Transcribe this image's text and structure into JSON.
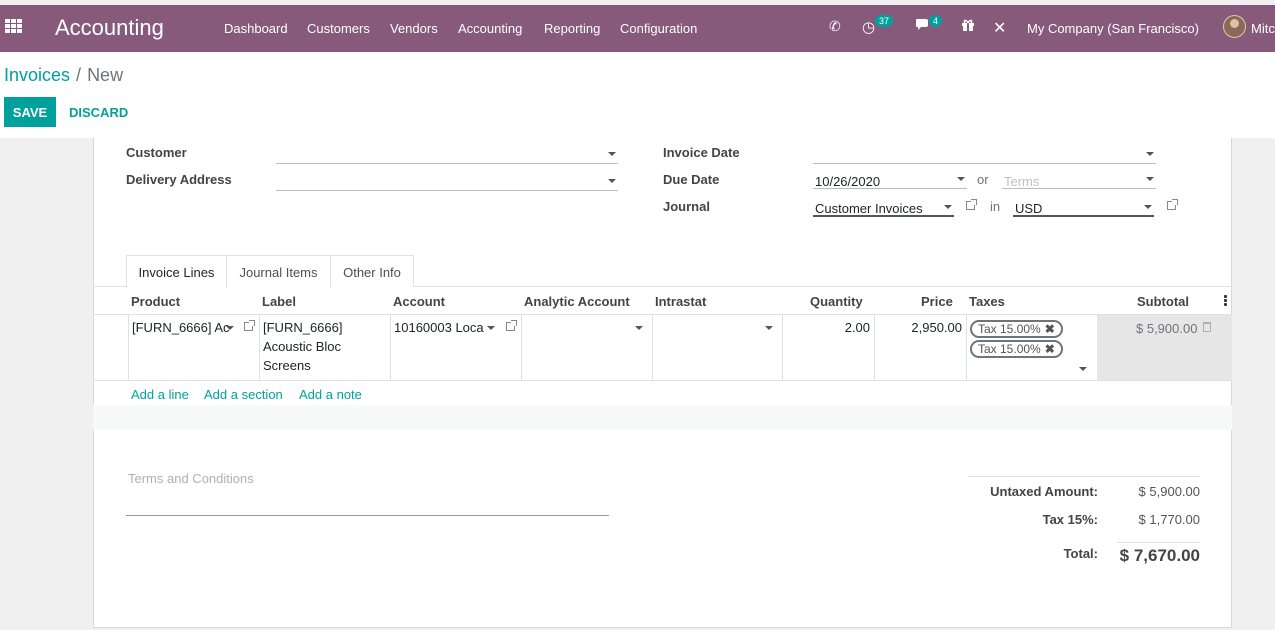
{
  "app": {
    "name": "Accounting"
  },
  "nav": {
    "items": [
      "Dashboard",
      "Customers",
      "Vendors",
      "Accounting",
      "Reporting",
      "Configuration"
    ]
  },
  "systray": {
    "activity_count": "37",
    "message_count": "4",
    "company": "My Company (San Francisco)",
    "user": "Mitc"
  },
  "breadcrumb": {
    "parent": "Invoices",
    "separator": "/",
    "current": "New"
  },
  "buttons": {
    "save": "SAVE",
    "discard": "DISCARD"
  },
  "form": {
    "customer_label": "Customer",
    "delivery_label": "Delivery Address",
    "invoice_date_label": "Invoice Date",
    "due_date_label": "Due Date",
    "due_date_value": "10/26/2020",
    "or_text": "or",
    "terms_placeholder": "Terms",
    "journal_label": "Journal",
    "journal_value": "Customer Invoices",
    "in_text": "in",
    "currency_value": "USD"
  },
  "tabs": [
    "Invoice Lines",
    "Journal Items",
    "Other Info"
  ],
  "table": {
    "headers": {
      "product": "Product",
      "label": "Label",
      "account": "Account",
      "analytic": "Analytic Account",
      "intrastat": "Intrastat",
      "quantity": "Quantity",
      "price": "Price",
      "taxes": "Taxes",
      "subtotal": "Subtotal"
    },
    "row": {
      "product": "[FURN_6666] Ac",
      "label_lines": [
        "[FURN_6666]",
        "Acoustic Bloc",
        "Screens"
      ],
      "account": "10160003 Loca",
      "quantity": "2.00",
      "price": "2,950.00",
      "taxes": [
        "Tax 15.00%",
        "Tax 15.00%"
      ],
      "subtotal": "$ 5,900.00"
    },
    "add_links": [
      "Add a line",
      "Add a section",
      "Add a note"
    ]
  },
  "footer": {
    "terms_placeholder": "Terms and Conditions",
    "untaxed_label": "Untaxed Amount:",
    "untaxed_value": "$ 5,900.00",
    "tax_label": "Tax 15%:",
    "tax_value": "$ 1,770.00",
    "total_label": "Total:",
    "total_value": "$ 7,670.00"
  },
  "colors": {
    "topbar": "#875a7b",
    "accent": "#00a09d"
  },
  "icons": [
    "apps-grid-icon",
    "phone-icon",
    "activity-icon",
    "chat-icon",
    "gift-icon",
    "tools-icon",
    "external-link-icon",
    "trash-icon",
    "kebab-menu-icon",
    "remove-tag-icon"
  ]
}
